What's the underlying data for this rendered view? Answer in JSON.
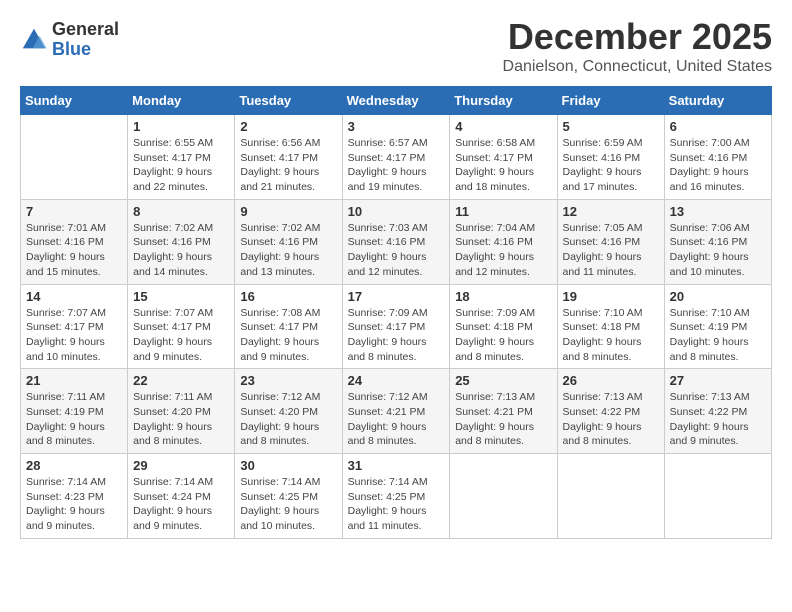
{
  "header": {
    "logo_general": "General",
    "logo_blue": "Blue",
    "month_title": "December 2025",
    "location": "Danielson, Connecticut, United States"
  },
  "days_of_week": [
    "Sunday",
    "Monday",
    "Tuesday",
    "Wednesday",
    "Thursday",
    "Friday",
    "Saturday"
  ],
  "weeks": [
    [
      {
        "day": "",
        "sunrise": "",
        "sunset": "",
        "daylight": ""
      },
      {
        "day": "1",
        "sunrise": "Sunrise: 6:55 AM",
        "sunset": "Sunset: 4:17 PM",
        "daylight": "Daylight: 9 hours and 22 minutes."
      },
      {
        "day": "2",
        "sunrise": "Sunrise: 6:56 AM",
        "sunset": "Sunset: 4:17 PM",
        "daylight": "Daylight: 9 hours and 21 minutes."
      },
      {
        "day": "3",
        "sunrise": "Sunrise: 6:57 AM",
        "sunset": "Sunset: 4:17 PM",
        "daylight": "Daylight: 9 hours and 19 minutes."
      },
      {
        "day": "4",
        "sunrise": "Sunrise: 6:58 AM",
        "sunset": "Sunset: 4:17 PM",
        "daylight": "Daylight: 9 hours and 18 minutes."
      },
      {
        "day": "5",
        "sunrise": "Sunrise: 6:59 AM",
        "sunset": "Sunset: 4:16 PM",
        "daylight": "Daylight: 9 hours and 17 minutes."
      },
      {
        "day": "6",
        "sunrise": "Sunrise: 7:00 AM",
        "sunset": "Sunset: 4:16 PM",
        "daylight": "Daylight: 9 hours and 16 minutes."
      }
    ],
    [
      {
        "day": "7",
        "sunrise": "Sunrise: 7:01 AM",
        "sunset": "Sunset: 4:16 PM",
        "daylight": "Daylight: 9 hours and 15 minutes."
      },
      {
        "day": "8",
        "sunrise": "Sunrise: 7:02 AM",
        "sunset": "Sunset: 4:16 PM",
        "daylight": "Daylight: 9 hours and 14 minutes."
      },
      {
        "day": "9",
        "sunrise": "Sunrise: 7:02 AM",
        "sunset": "Sunset: 4:16 PM",
        "daylight": "Daylight: 9 hours and 13 minutes."
      },
      {
        "day": "10",
        "sunrise": "Sunrise: 7:03 AM",
        "sunset": "Sunset: 4:16 PM",
        "daylight": "Daylight: 9 hours and 12 minutes."
      },
      {
        "day": "11",
        "sunrise": "Sunrise: 7:04 AM",
        "sunset": "Sunset: 4:16 PM",
        "daylight": "Daylight: 9 hours and 12 minutes."
      },
      {
        "day": "12",
        "sunrise": "Sunrise: 7:05 AM",
        "sunset": "Sunset: 4:16 PM",
        "daylight": "Daylight: 9 hours and 11 minutes."
      },
      {
        "day": "13",
        "sunrise": "Sunrise: 7:06 AM",
        "sunset": "Sunset: 4:16 PM",
        "daylight": "Daylight: 9 hours and 10 minutes."
      }
    ],
    [
      {
        "day": "14",
        "sunrise": "Sunrise: 7:07 AM",
        "sunset": "Sunset: 4:17 PM",
        "daylight": "Daylight: 9 hours and 10 minutes."
      },
      {
        "day": "15",
        "sunrise": "Sunrise: 7:07 AM",
        "sunset": "Sunset: 4:17 PM",
        "daylight": "Daylight: 9 hours and 9 minutes."
      },
      {
        "day": "16",
        "sunrise": "Sunrise: 7:08 AM",
        "sunset": "Sunset: 4:17 PM",
        "daylight": "Daylight: 9 hours and 9 minutes."
      },
      {
        "day": "17",
        "sunrise": "Sunrise: 7:09 AM",
        "sunset": "Sunset: 4:17 PM",
        "daylight": "Daylight: 9 hours and 8 minutes."
      },
      {
        "day": "18",
        "sunrise": "Sunrise: 7:09 AM",
        "sunset": "Sunset: 4:18 PM",
        "daylight": "Daylight: 9 hours and 8 minutes."
      },
      {
        "day": "19",
        "sunrise": "Sunrise: 7:10 AM",
        "sunset": "Sunset: 4:18 PM",
        "daylight": "Daylight: 9 hours and 8 minutes."
      },
      {
        "day": "20",
        "sunrise": "Sunrise: 7:10 AM",
        "sunset": "Sunset: 4:19 PM",
        "daylight": "Daylight: 9 hours and 8 minutes."
      }
    ],
    [
      {
        "day": "21",
        "sunrise": "Sunrise: 7:11 AM",
        "sunset": "Sunset: 4:19 PM",
        "daylight": "Daylight: 9 hours and 8 minutes."
      },
      {
        "day": "22",
        "sunrise": "Sunrise: 7:11 AM",
        "sunset": "Sunset: 4:20 PM",
        "daylight": "Daylight: 9 hours and 8 minutes."
      },
      {
        "day": "23",
        "sunrise": "Sunrise: 7:12 AM",
        "sunset": "Sunset: 4:20 PM",
        "daylight": "Daylight: 9 hours and 8 minutes."
      },
      {
        "day": "24",
        "sunrise": "Sunrise: 7:12 AM",
        "sunset": "Sunset: 4:21 PM",
        "daylight": "Daylight: 9 hours and 8 minutes."
      },
      {
        "day": "25",
        "sunrise": "Sunrise: 7:13 AM",
        "sunset": "Sunset: 4:21 PM",
        "daylight": "Daylight: 9 hours and 8 minutes."
      },
      {
        "day": "26",
        "sunrise": "Sunrise: 7:13 AM",
        "sunset": "Sunset: 4:22 PM",
        "daylight": "Daylight: 9 hours and 8 minutes."
      },
      {
        "day": "27",
        "sunrise": "Sunrise: 7:13 AM",
        "sunset": "Sunset: 4:22 PM",
        "daylight": "Daylight: 9 hours and 9 minutes."
      }
    ],
    [
      {
        "day": "28",
        "sunrise": "Sunrise: 7:14 AM",
        "sunset": "Sunset: 4:23 PM",
        "daylight": "Daylight: 9 hours and 9 minutes."
      },
      {
        "day": "29",
        "sunrise": "Sunrise: 7:14 AM",
        "sunset": "Sunset: 4:24 PM",
        "daylight": "Daylight: 9 hours and 9 minutes."
      },
      {
        "day": "30",
        "sunrise": "Sunrise: 7:14 AM",
        "sunset": "Sunset: 4:25 PM",
        "daylight": "Daylight: 9 hours and 10 minutes."
      },
      {
        "day": "31",
        "sunrise": "Sunrise: 7:14 AM",
        "sunset": "Sunset: 4:25 PM",
        "daylight": "Daylight: 9 hours and 11 minutes."
      },
      {
        "day": "",
        "sunrise": "",
        "sunset": "",
        "daylight": ""
      },
      {
        "day": "",
        "sunrise": "",
        "sunset": "",
        "daylight": ""
      },
      {
        "day": "",
        "sunrise": "",
        "sunset": "",
        "daylight": ""
      }
    ]
  ]
}
